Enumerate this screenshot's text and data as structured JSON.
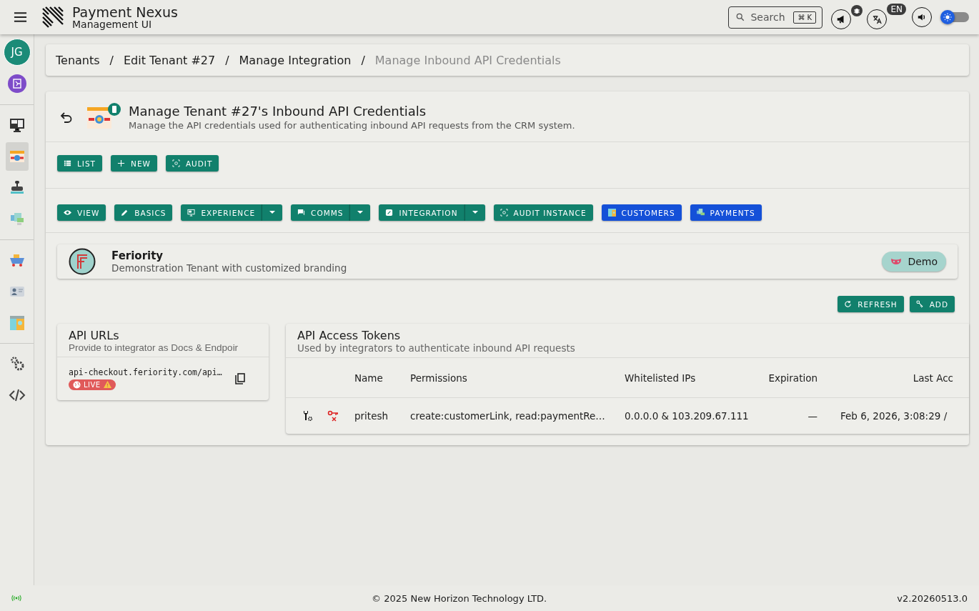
{
  "app": {
    "title": "Payment Nexus",
    "subtitle": "Management UI"
  },
  "search": {
    "placeholder": "Search",
    "shortcut": "⌘ K"
  },
  "language": {
    "badge": "EN"
  },
  "theme_toggle": {
    "on": false
  },
  "user": {
    "initials": "JG"
  },
  "sidebar": {
    "items": [
      {
        "kind": "monitor",
        "selected": false
      },
      {
        "kind": "certificate",
        "selected": true
      },
      {
        "kind": "stamp",
        "selected": false
      },
      {
        "kind": "cards",
        "selected": false
      },
      {
        "kind": "cart",
        "selected": false
      },
      {
        "kind": "idcard",
        "selected": false
      },
      {
        "kind": "profile",
        "selected": false
      },
      {
        "kind": "gears",
        "selected": false
      },
      {
        "kind": "code",
        "selected": false
      }
    ]
  },
  "breadcrumb": {
    "separator": "/",
    "items": [
      {
        "label": "Tenants",
        "current": false
      },
      {
        "label": "Edit Tenant #27",
        "current": false
      },
      {
        "label": "Manage Integration",
        "current": false
      },
      {
        "label": "Manage Inbound API Credentials",
        "current": true
      }
    ]
  },
  "page": {
    "title": "Manage Tenant #27's Inbound API Credentials",
    "description": "Manage the API credentials used for authenticating inbound API requests from the CRM system."
  },
  "actions": [
    {
      "label": "LIST",
      "kind": "list"
    },
    {
      "label": "NEW",
      "kind": "plus"
    },
    {
      "label": "AUDIT",
      "kind": "audit"
    }
  ],
  "tabs": [
    {
      "label": "VIEW",
      "kind": "eye",
      "dropdown": false,
      "color": "#11806c"
    },
    {
      "label": "BASICS",
      "kind": "pencil",
      "dropdown": false,
      "color": "#11806c"
    },
    {
      "label": "EXPERIENCE",
      "kind": "monitor",
      "dropdown": true,
      "color": "#11806c"
    },
    {
      "label": "COMMS",
      "kind": "chat",
      "dropdown": true,
      "color": "#11806c"
    },
    {
      "label": "INTEGRATION",
      "kind": "link",
      "dropdown": true,
      "color": "#11806c"
    },
    {
      "label": "AUDIT INSTANCE",
      "kind": "audit",
      "dropdown": false,
      "color": "#11806c"
    },
    {
      "label": "CUSTOMERS",
      "kind": "profile",
      "dropdown": false,
      "color": "#1450d8"
    },
    {
      "label": "PAYMENTS",
      "kind": "cards",
      "dropdown": false,
      "color": "#1450d8"
    }
  ],
  "tenant": {
    "name": "Feriority",
    "description": "Demonstration Tenant with customized branding",
    "badge": "Demo"
  },
  "toolbar": [
    {
      "label": "REFRESH",
      "kind": "refresh"
    },
    {
      "label": "ADD",
      "kind": "key"
    }
  ],
  "api_urls": {
    "title": "API URLs",
    "subtitle": "Provide to integrator as Docs & Endpoir",
    "items": [
      {
        "url": "api-checkout.feriority.com/api…",
        "env": "LIVE"
      }
    ]
  },
  "tokens": {
    "title": "API Access Tokens",
    "subtitle": "Used by integrators to authenticate inbound API requests",
    "columns": [
      "Name",
      "Permissions",
      "Whitelisted IPs",
      "Expiration",
      "Last Acc"
    ],
    "rows": [
      {
        "name": "pritesh",
        "permissions": "create:customerLink, read:paymentRe…",
        "ips": "0.0.0.0 & 103.209.67.111",
        "expiration": "—",
        "last_access": "Feb 6, 2026, 3:08:29 /"
      }
    ]
  },
  "footer": {
    "copyright": "© 2025 New Horizon Technology LTD.",
    "version": "v2.20260513.0"
  }
}
